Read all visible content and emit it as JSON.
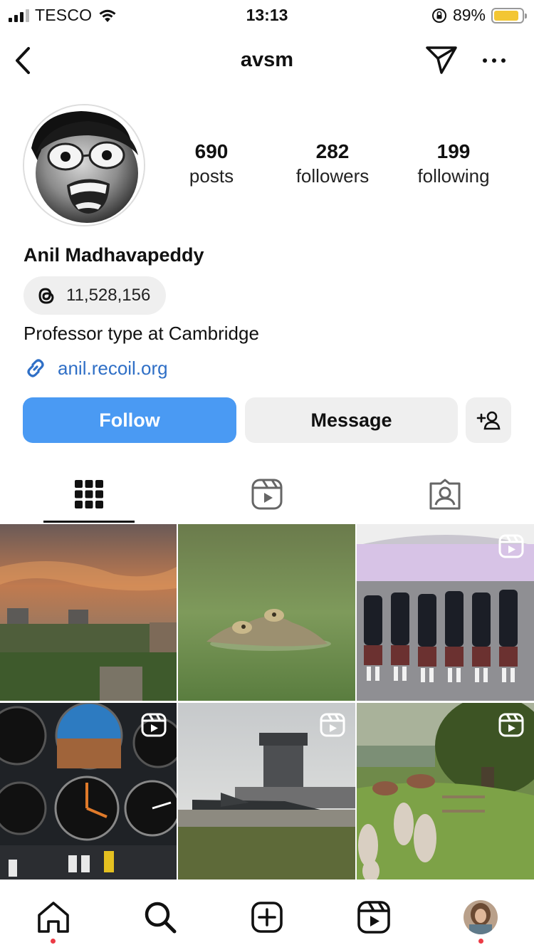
{
  "status_bar": {
    "carrier": "TESCO",
    "time": "13:13",
    "battery": "89%",
    "battery_level": 0.89
  },
  "header": {
    "username": "avsm"
  },
  "profile": {
    "stats": [
      {
        "value": "690",
        "label": "posts"
      },
      {
        "value": "282",
        "label": "followers"
      },
      {
        "value": "199",
        "label": "following"
      }
    ],
    "name": "Anil Madhavapeddy",
    "threads_count": "11,528,156",
    "bio": "Professor type at Cambridge",
    "link": "anil.recoil.org"
  },
  "actions": {
    "follow": "Follow",
    "message": "Message"
  },
  "tabs": [
    "grid",
    "reels",
    "tagged"
  ],
  "colors": {
    "accent": "#4a9af3",
    "link": "#2f6fc6",
    "notification_dot": "#ec3b45"
  }
}
